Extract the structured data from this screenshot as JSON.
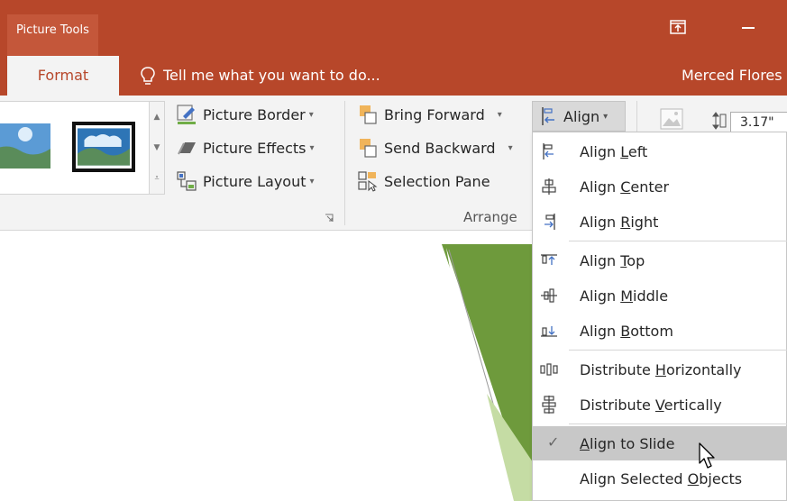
{
  "titlebar": {
    "context_tab": "Picture Tools"
  },
  "tabs": {
    "format": "Format",
    "tell_me": "Tell me what you want to do...",
    "user": "Merced Flores"
  },
  "picture_styles": {
    "border": "Picture Border",
    "effects": "Picture Effects",
    "layout": "Picture Layout"
  },
  "arrange": {
    "bring_forward": "Bring Forward",
    "send_backward": "Send Backward",
    "selection_pane": "Selection Pane",
    "group_label": "Arrange",
    "align": "Align"
  },
  "size": {
    "height_value": "3.17\""
  },
  "align_menu": {
    "items": [
      {
        "label": "Align Left",
        "key": "L"
      },
      {
        "label": "Align Center",
        "key": "C"
      },
      {
        "label": "Align Right",
        "key": "R"
      },
      {
        "label": "Align Top",
        "key": "T"
      },
      {
        "label": "Align Middle",
        "key": "M"
      },
      {
        "label": "Align Bottom",
        "key": "B"
      },
      {
        "label": "Distribute Horizontally",
        "key": "H"
      },
      {
        "label": "Distribute Vertically",
        "key": "V"
      },
      {
        "label": "Align to Slide",
        "key": "A",
        "checked": true,
        "highlighted": true
      },
      {
        "label": "Align Selected Objects",
        "key": "O"
      }
    ]
  },
  "colors": {
    "accent": "#b7472a",
    "ribbon": "#f3f3f3",
    "slide_green": "#6e9a3c"
  },
  "icons": [
    "restore-icon",
    "minimize-icon",
    "bulb-icon",
    "picture-border-icon",
    "picture-effects-icon",
    "picture-layout-icon",
    "bring-forward-icon",
    "send-backward-icon",
    "selection-pane-icon",
    "align-icon",
    "check-icon",
    "cursor-icon"
  ]
}
